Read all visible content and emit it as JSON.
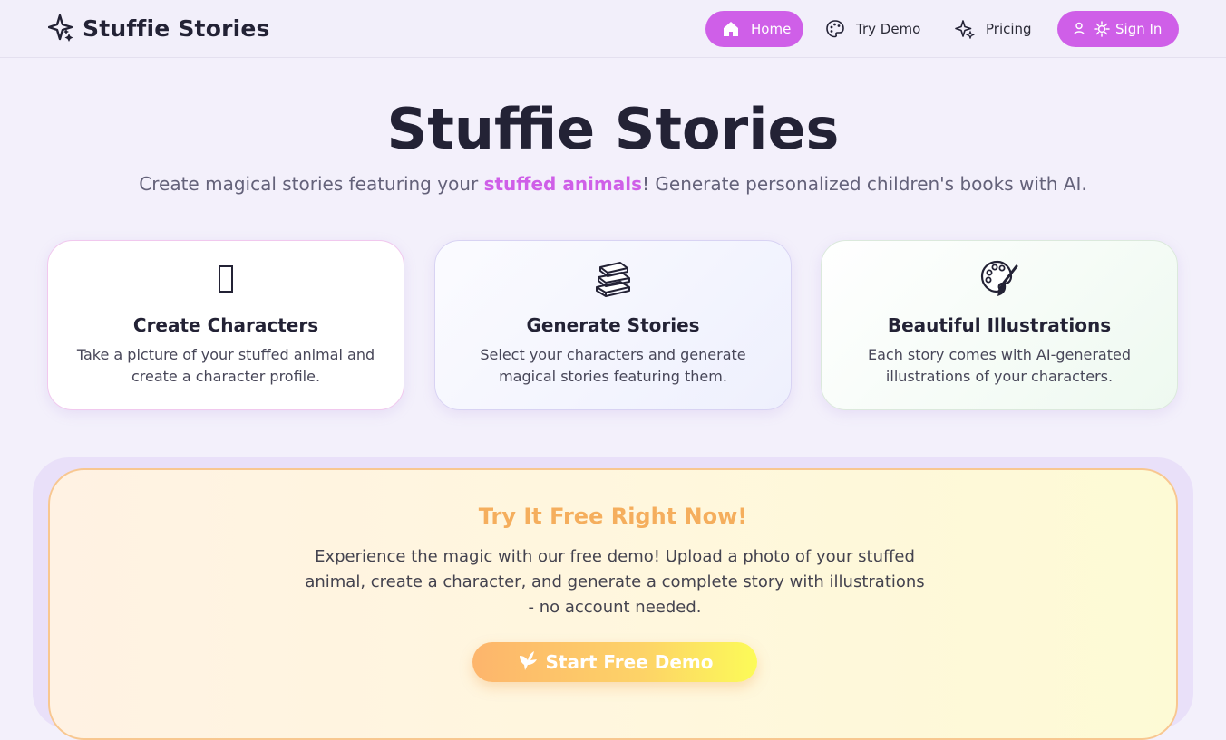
{
  "brand": {
    "name": "Stuffie Stories"
  },
  "nav": {
    "home": "Home",
    "demo": "Try Demo",
    "pricing": "Pricing",
    "signin": "Sign In"
  },
  "hero": {
    "title": "Stuffie Stories",
    "subtitle_pre": "Create magical stories featuring your ",
    "subtitle_highlight": "stuffed animals",
    "subtitle_post": "! Generate personalized children's books with AI."
  },
  "features": [
    {
      "title": "Create Characters",
      "description": "Take a picture of your stuffed animal and create a character profile.",
      "icon": "missing-glyph-icon"
    },
    {
      "title": "Generate Stories",
      "description": "Select your characters and generate magical stories featuring them.",
      "icon": "books-icon"
    },
    {
      "title": "Beautiful Illustrations",
      "description": "Each story comes with AI-generated illustrations of your characters.",
      "icon": "palette-icon"
    }
  ],
  "cta": {
    "title": "Try It Free Right Now!",
    "text": "Experience the magic with our free demo! Upload a photo of your stuffed animal, create a character, and generate a complete story with illustrations - no account needed.",
    "button": "Start Free Demo"
  },
  "colors": {
    "accent": "#cf5fe8",
    "background": "#f3f0fb",
    "cta_title": "#f5ae5d"
  }
}
